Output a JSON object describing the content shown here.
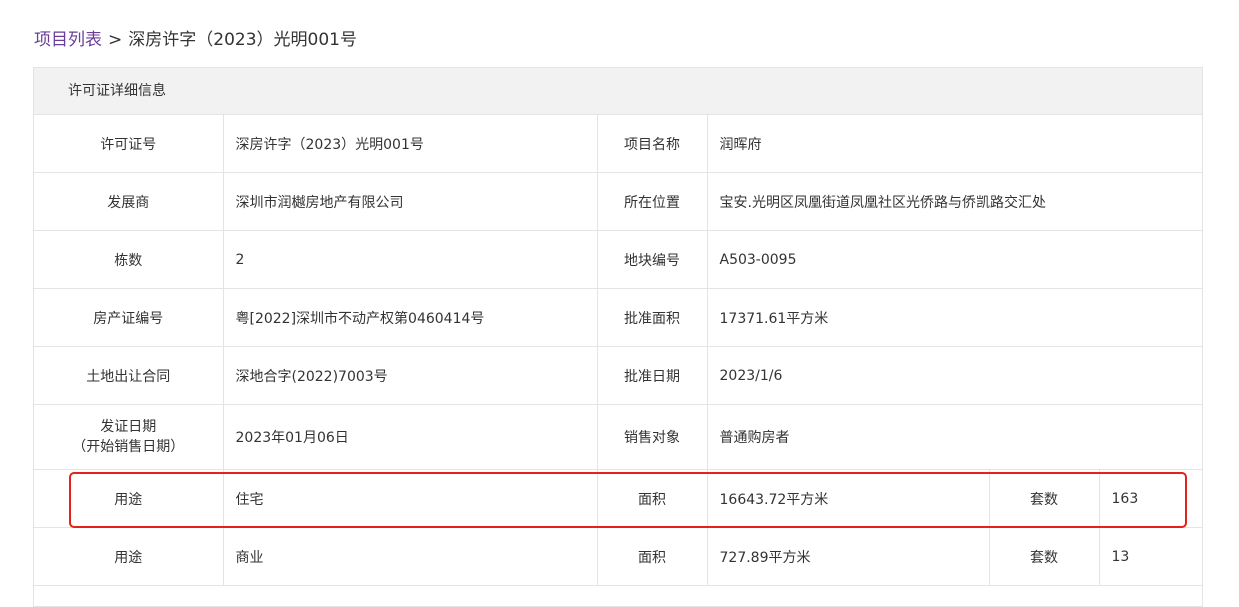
{
  "breadcrumb": {
    "link": "项目列表",
    "separator": ">",
    "current": "深房许字（2023）光明001号"
  },
  "panel": {
    "title": "许可证详细信息"
  },
  "rows": [
    {
      "l1": "许可证号",
      "v1": "深房许字（2023）光明001号",
      "l2": "项目名称",
      "v2": "润晖府"
    },
    {
      "l1": "发展商",
      "v1": "深圳市润樾房地产有限公司",
      "l2": "所在位置",
      "v2": "宝安.光明区凤凰街道凤凰社区光侨路与侨凯路交汇处"
    },
    {
      "l1": "栋数",
      "v1": "2",
      "l2": "地块编号",
      "v2": "A503-0095"
    },
    {
      "l1": "房产证编号",
      "v1": "粤[2022]深圳市不动产权第0460414号",
      "l2": "批准面积",
      "v2": "17371.61平方米"
    },
    {
      "l1": "土地出让合同",
      "v1": "深地合字(2022)7003号",
      "l2": "批准日期",
      "v2": "2023/1/6"
    },
    {
      "l1a": "发证日期",
      "l1b": "（开始销售日期）",
      "v1": "2023年01月06日",
      "l2": "销售对象",
      "v2": "普通购房者"
    }
  ],
  "usage_rows": [
    {
      "usage_label": "用途",
      "usage": "住宅",
      "area_label": "面积",
      "area": "16643.72平方米",
      "units_label": "套数",
      "units": "163"
    },
    {
      "usage_label": "用途",
      "usage": "商业",
      "area_label": "面积",
      "area": "727.89平方米",
      "units_label": "套数",
      "units": "13"
    }
  ],
  "colors": {
    "link": "#6a3d9a",
    "highlight": "#e2231a",
    "header_bg": "#f2f2f2",
    "border": "#e4e4e4"
  }
}
